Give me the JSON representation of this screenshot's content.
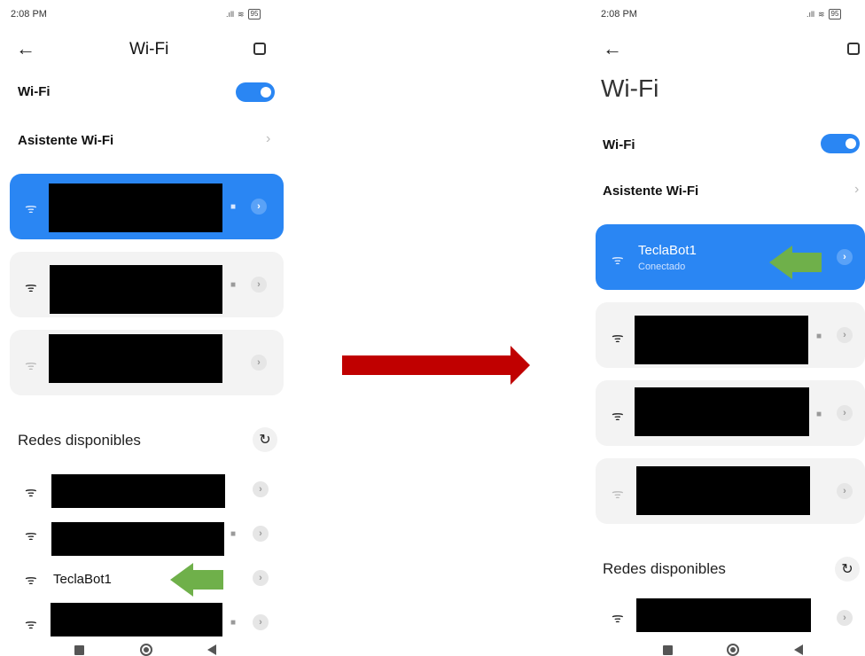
{
  "left": {
    "status_bar": {
      "time": "2:08 PM",
      "signal": ".ıll",
      "battery": "95"
    },
    "header": {
      "title": "Wi-Fi"
    },
    "wifi_toggle": {
      "label": "Wi-Fi",
      "state": "on"
    },
    "assistant": {
      "label": "Asistente Wi-Fi"
    },
    "saved_networks": [
      {
        "name": "",
        "locked": true,
        "connected": true
      },
      {
        "name": "",
        "locked": true,
        "connected": false
      },
      {
        "name": "",
        "locked": false,
        "connected": false
      }
    ],
    "available": {
      "title": "Redes disponibles",
      "networks": [
        {
          "name": "",
          "locked": false
        },
        {
          "name": "",
          "locked": true
        },
        {
          "name": "TeclaBot1",
          "locked": false
        },
        {
          "name": "",
          "locked": true
        }
      ]
    }
  },
  "right": {
    "status_bar": {
      "time": "2:08 PM",
      "signal": ".ıll",
      "battery": "95"
    },
    "header": {
      "title": "Wi-Fi"
    },
    "wifi_toggle": {
      "label": "Wi-Fi",
      "state": "on"
    },
    "assistant": {
      "label": "Asistente Wi-Fi"
    },
    "connected_network": {
      "name": "TeclaBot1",
      "status": "Conectado"
    },
    "saved_networks": [
      {
        "name": "",
        "locked": true
      },
      {
        "name": "",
        "locked": true
      },
      {
        "name": "",
        "locked": false
      }
    ],
    "available": {
      "title": "Redes disponibles",
      "networks": [
        {
          "name": "",
          "locked": false
        }
      ]
    }
  },
  "colors": {
    "accent": "#2a86f3",
    "arrow_red": "#c00000",
    "arrow_green": "#6fb04a",
    "card_bg": "#f3f3f3",
    "redaction": "#000000"
  },
  "icons": {
    "wifi": "wifi-icon",
    "back": "back-arrow-icon",
    "scan": "scan-icon",
    "lock": "lock-icon",
    "chevron": "chevron-right-icon",
    "refresh": "refresh-icon"
  }
}
